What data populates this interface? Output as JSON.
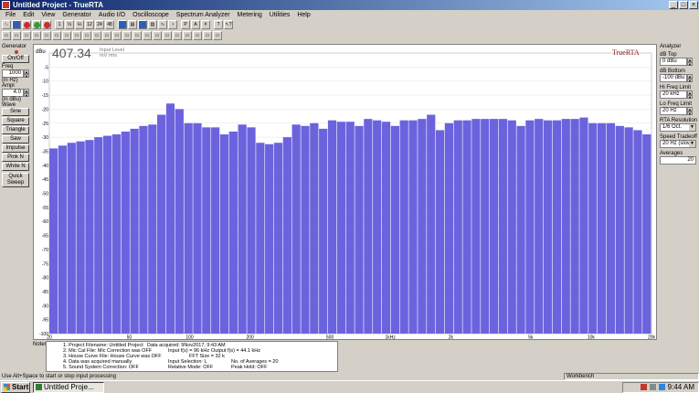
{
  "window": {
    "title": "Untitled Project - TrueRTA"
  },
  "menu": [
    "File",
    "Edit",
    "View",
    "Generator",
    "Audio I/O",
    "Oscilloscope",
    "Spectrum Analyzer",
    "Metering",
    "Utilities",
    "Help"
  ],
  "generator": {
    "group_label": "Generator",
    "on_off": "On/Off",
    "freq_label": "Freq",
    "freq_value": "1000",
    "freq_unit": "(in Hz)",
    "ampl_label": "Ampl",
    "ampl_value": "4.0",
    "ampl_unit": "(in dBu)",
    "wave_label": "Wave",
    "waves": [
      "Sine",
      "Square",
      "Triangle",
      "Saw",
      "Impulse",
      "Pink N",
      "White N"
    ],
    "quick_sweep": "Quick Sweep"
  },
  "analyzer": {
    "group_label": "Analyzer",
    "db_top_label": "dB Top",
    "db_top_value": "0 dBu",
    "db_bottom_label": "dB Bottom",
    "db_bottom_value": "-100 dBu",
    "hi_freq_label": "Hi Freq Limit",
    "hi_freq_value": "20 kHz",
    "lo_freq_label": "Lo Freq Limit",
    "lo_freq_value": "20 Hz",
    "rta_res_label": "RTA Resolution",
    "rta_res_value": "1/6 Oct.",
    "speed_label": "Speed Tradeoff",
    "speed_value": "20 Hz (slow)",
    "averages_label": "Averages",
    "averages_value": "20"
  },
  "readout": {
    "value": "407.34",
    "label1": "Input Level",
    "label2": "mV rms"
  },
  "brand": "TrueRTA",
  "chart_data": {
    "type": "bar",
    "ylabel": "dBu",
    "ylim": [
      -100,
      0
    ],
    "yticks": [
      -5,
      -10,
      -15,
      -20,
      -25,
      -30,
      -35,
      -40,
      -45,
      -50,
      -55,
      -60,
      -65,
      -70,
      -75,
      -80,
      -85,
      -90,
      -95,
      -100
    ],
    "xscale": "log",
    "xlim": [
      20,
      20000
    ],
    "xticks": [
      "20",
      "50",
      "100",
      "200",
      "500",
      "1kHz",
      "2k",
      "5k",
      "10k",
      "20k"
    ],
    "xtick_values": [
      20,
      50,
      100,
      200,
      500,
      1000,
      2000,
      5000,
      10000,
      20000
    ],
    "bar_color": "#6b63dd",
    "values": [
      -34,
      -33,
      -32,
      -31.5,
      -31,
      -30,
      -29.5,
      -29,
      -28,
      -27,
      -26,
      -25.5,
      -22,
      -18,
      -20,
      -25,
      -25,
      -26.5,
      -26.5,
      -29,
      -28,
      -25.5,
      -26.5,
      -32,
      -32.5,
      -32,
      -30,
      -25.5,
      -26,
      -25,
      -27,
      -24,
      -24.5,
      -24.5,
      -26,
      -23.5,
      -24,
      -24.5,
      -26,
      -24,
      -24,
      -23.5,
      -22,
      -27.5,
      -25,
      -24,
      -24,
      -23.5,
      -23.5,
      -23.5,
      -23.5,
      -24,
      -26,
      -24,
      -23.5,
      -24,
      -24,
      -23.5,
      -23.5,
      -23,
      -25,
      -25,
      -25,
      -26,
      -26.5,
      -27.5,
      -29
    ]
  },
  "notes": {
    "label": "Notes:",
    "lines": [
      "1. Project Filename: Untitled Project",
      "2. Mic Cal File: Mic Correction was OFF",
      "3. House Curve File: House Curve was OFF",
      "4. Data was acquired manually",
      "5. Sound System Correction: OFF"
    ],
    "data_acquired": "Data acquired: 9Nov2017, 9:43 AM",
    "input_fs": "Input f(s) = 96 kHz",
    "output_fs": "Output f(s) = 44.1 kHz",
    "fft_size": "FFT Size = 32 k",
    "input_selection": "Input Selection: L",
    "num_averages": "No. of Averages = 20",
    "relative_mode": "Relative Mode: OFF",
    "peak_hold": "Peak Hold: OFF"
  },
  "status": {
    "text": "Use Alt+Space to start or stop input processing",
    "panel": "Workbench"
  },
  "taskbar": {
    "start": "Start",
    "task": "Untitled Proje...",
    "clock": "9:44 AM"
  }
}
